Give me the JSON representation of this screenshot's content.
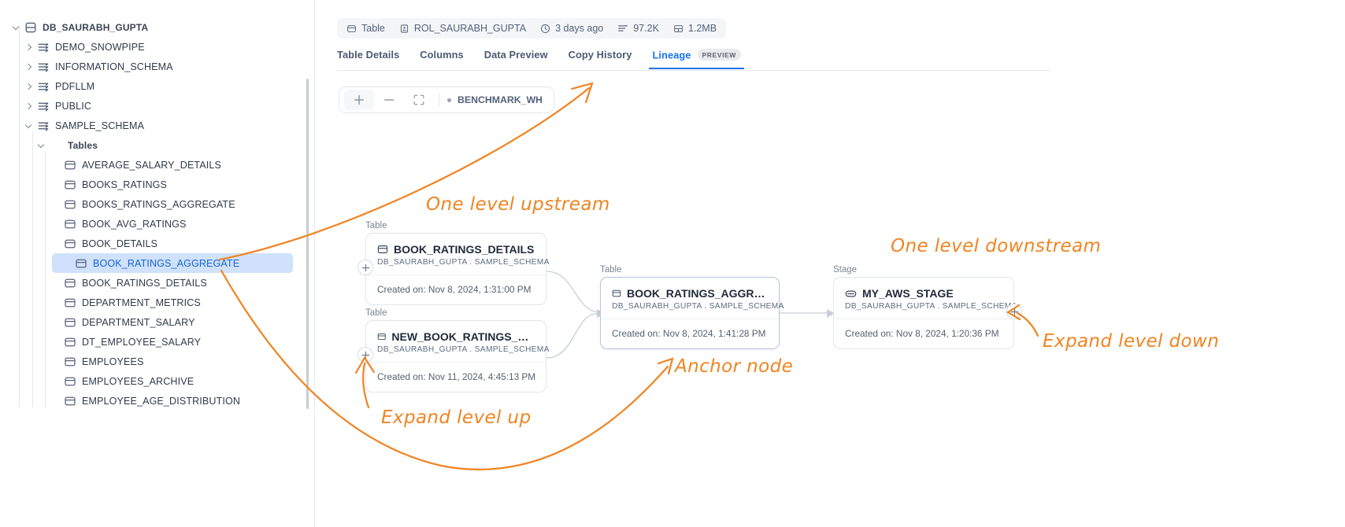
{
  "sidebar": {
    "tree": [
      {
        "label": "DB_SAURABH_GUPTA",
        "icon": "database-icon",
        "level": 0,
        "expanded": true,
        "selected": false,
        "bold": true
      },
      {
        "label": "DEMO_SNOWPIPE",
        "icon": "schema-icon",
        "level": 1,
        "expanded": false,
        "selected": false,
        "bold": false
      },
      {
        "label": "INFORMATION_SCHEMA",
        "icon": "schema-icon",
        "level": 1,
        "expanded": false,
        "selected": false,
        "bold": false
      },
      {
        "label": "PDFLLM",
        "icon": "schema-icon",
        "level": 1,
        "expanded": false,
        "selected": false,
        "bold": false
      },
      {
        "label": "PUBLIC",
        "icon": "schema-icon",
        "level": 1,
        "expanded": false,
        "selected": false,
        "bold": false
      },
      {
        "label": "SAMPLE_SCHEMA",
        "icon": "schema-icon",
        "level": 1,
        "expanded": true,
        "selected": false,
        "bold": false
      },
      {
        "label": "Tables",
        "icon": "none",
        "level": 2,
        "expanded": true,
        "selected": false,
        "bold": true
      },
      {
        "label": "AVERAGE_SALARY_DETAILS",
        "icon": "table-icon",
        "level": 3,
        "expanded": null,
        "selected": false,
        "bold": false
      },
      {
        "label": "BOOKS_RATINGS",
        "icon": "table-icon",
        "level": 3,
        "expanded": null,
        "selected": false,
        "bold": false
      },
      {
        "label": "BOOKS_RATINGS_AGGREGATE",
        "icon": "table-icon",
        "level": 3,
        "expanded": null,
        "selected": false,
        "bold": false
      },
      {
        "label": "BOOK_AVG_RATINGS",
        "icon": "table-icon",
        "level": 3,
        "expanded": null,
        "selected": false,
        "bold": false
      },
      {
        "label": "BOOK_DETAILS",
        "icon": "table-icon",
        "level": 3,
        "expanded": null,
        "selected": false,
        "bold": false
      },
      {
        "label": "BOOK_RATINGS_AGGREGATE",
        "icon": "table-icon",
        "level": 3,
        "expanded": null,
        "selected": true,
        "bold": false
      },
      {
        "label": "BOOK_RATINGS_DETAILS",
        "icon": "table-icon",
        "level": 3,
        "expanded": null,
        "selected": false,
        "bold": false
      },
      {
        "label": "DEPARTMENT_METRICS",
        "icon": "table-icon",
        "level": 3,
        "expanded": null,
        "selected": false,
        "bold": false
      },
      {
        "label": "DEPARTMENT_SALARY",
        "icon": "table-icon",
        "level": 3,
        "expanded": null,
        "selected": false,
        "bold": false
      },
      {
        "label": "DT_EMPLOYEE_SALARY",
        "icon": "table-icon",
        "level": 3,
        "expanded": null,
        "selected": false,
        "bold": false
      },
      {
        "label": "EMPLOYEES",
        "icon": "table-icon",
        "level": 3,
        "expanded": null,
        "selected": false,
        "bold": false
      },
      {
        "label": "EMPLOYEES_ARCHIVE",
        "icon": "table-icon",
        "level": 3,
        "expanded": null,
        "selected": false,
        "bold": false
      },
      {
        "label": "EMPLOYEE_AGE_DISTRIBUTION",
        "icon": "table-icon",
        "level": 3,
        "expanded": null,
        "selected": false,
        "bold": false
      }
    ]
  },
  "meta_chips": [
    {
      "icon": "table-icon",
      "label": "Table"
    },
    {
      "icon": "role-icon",
      "label": "ROL_SAURABH_GUPTA"
    },
    {
      "icon": "clock-icon",
      "label": "3 days ago"
    },
    {
      "icon": "rows-icon",
      "label": "97.2K"
    },
    {
      "icon": "size-icon",
      "label": "1.2MB"
    }
  ],
  "tabs": [
    {
      "label": "Table Details",
      "active": false,
      "badge": null
    },
    {
      "label": "Columns",
      "active": false,
      "badge": null
    },
    {
      "label": "Data Preview",
      "active": false,
      "badge": null
    },
    {
      "label": "Copy History",
      "active": false,
      "badge": null
    },
    {
      "label": "Lineage",
      "active": true,
      "badge": "PREVIEW"
    }
  ],
  "zoom_toolbar": {
    "zoom_in": "+",
    "zoom_out": "−",
    "fit_label": "fit-to-screen",
    "warehouse": "BENCHMARK_WH"
  },
  "graph": {
    "nodes": [
      {
        "id": "book_ratings_details",
        "type_label": "Table",
        "icon": "table-icon",
        "title": "BOOK_RATINGS_DETAILS",
        "path": "DB_SAURABH_GUPTA . SAMPLE_SCHEMA",
        "footer": "Created on: Nov 8, 2024, 1:31:00 PM",
        "anchor": false,
        "expand_handle": "left"
      },
      {
        "id": "new_book_ratings_aggregate",
        "type_label": "Table",
        "icon": "table-icon",
        "title": "NEW_BOOK_RATINGS_AGGRE...",
        "path": "DB_SAURABH_GUPTA . SAMPLE_SCHEMA",
        "footer": "Created on: Nov 11, 2024, 4:45:13 PM",
        "anchor": false,
        "expand_handle": "left"
      },
      {
        "id": "book_ratings_aggregate",
        "type_label": "Table",
        "icon": "table-icon",
        "title": "BOOK_RATINGS_AGGREGATE",
        "path": "DB_SAURABH_GUPTA . SAMPLE_SCHEMA",
        "footer": "Created on: Nov 8, 2024, 1:41:28 PM",
        "anchor": true,
        "expand_handle": "none"
      },
      {
        "id": "my_aws_stage",
        "type_label": "Stage",
        "icon": "stage-icon",
        "title": "MY_AWS_STAGE",
        "path": "DB_SAURABH_GUPTA . SAMPLE_SCHEMA",
        "footer": "Created on: Nov 8, 2024, 1:20:36 PM",
        "anchor": false,
        "expand_handle": "right"
      }
    ],
    "expand_symbol": "+"
  },
  "annotations": {
    "accent_color": "#f08421",
    "items": [
      {
        "id": "one-level-upstream",
        "text": "One level upstream"
      },
      {
        "id": "one-level-downstream",
        "text": "One level downstream"
      },
      {
        "id": "expand-level-down",
        "text": "Expand level down"
      },
      {
        "id": "anchor-node",
        "text": "Anchor node"
      },
      {
        "id": "expand-level-up",
        "text": "Expand level up"
      }
    ]
  }
}
